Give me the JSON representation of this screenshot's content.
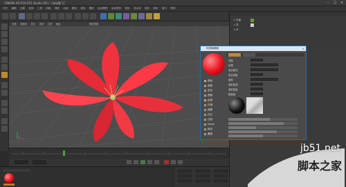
{
  "window": {
    "title": "CINEMA 4D R16.021 Studio (RC) - [未标题 1]"
  },
  "menu": [
    "文件",
    "编辑",
    "创建",
    "选择",
    "工具",
    "网格",
    "捕捉",
    "动画",
    "模拟",
    "渲染",
    "雕刻",
    "运动跟踪",
    "运动图形",
    "角色",
    "流水线",
    "插件",
    "脚本",
    "窗口",
    "帮助"
  ],
  "viewport": {
    "menu": [
      "查看",
      "摄像机",
      "显示",
      "选项",
      "过滤",
      "面板"
    ],
    "label": "透视视图"
  },
  "objects": [
    "平面",
    "花",
    "叶"
  ],
  "material_editor": {
    "title": "材质编辑器",
    "channels": [
      {
        "label": "颜色",
        "on": true
      },
      {
        "label": "漫射",
        "on": false
      },
      {
        "label": "发光",
        "on": false
      },
      {
        "label": "透明",
        "on": false
      },
      {
        "label": "反射",
        "on": true
      },
      {
        "label": "环境",
        "on": false
      },
      {
        "label": "烟雾",
        "on": false
      },
      {
        "label": "凹凸",
        "on": false
      },
      {
        "label": "法线",
        "on": false
      },
      {
        "label": "Alpha",
        "on": false
      },
      {
        "label": "辉光",
        "on": false
      },
      {
        "label": "置换",
        "on": false
      }
    ],
    "fields": [
      "亮度",
      "纹理",
      "混合模式",
      "混合强度",
      "模型",
      "漫射衰减",
      "漫射层级",
      "粗糙度"
    ]
  },
  "watermark": {
    "top": "jb51.net",
    "bottom": "脚本之家"
  },
  "colors": {
    "accent": "#1c6fb5",
    "flower": "#ff3040",
    "viewport": "#4d4d4d"
  }
}
